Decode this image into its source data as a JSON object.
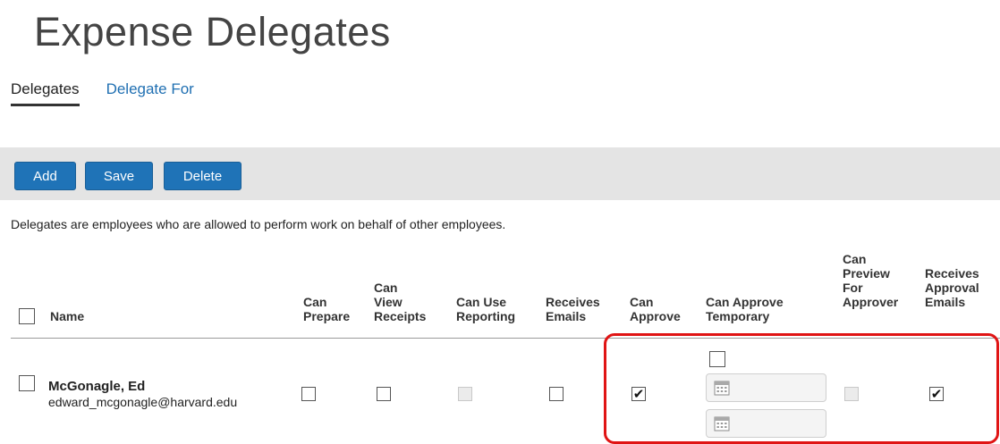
{
  "page": {
    "title": "Expense Delegates"
  },
  "tabs": [
    {
      "label": "Delegates",
      "active": true
    },
    {
      "label": "Delegate For",
      "active": false
    }
  ],
  "toolbar": {
    "add_label": "Add",
    "save_label": "Save",
    "delete_label": "Delete"
  },
  "description": "Delegates are employees who are allowed to perform work on behalf of other employees.",
  "table": {
    "headers": {
      "name": "Name",
      "can_prepare": "Can\nPrepare",
      "can_view_receipts": "Can\nView\nReceipts",
      "can_use_reporting": "Can Use\nReporting",
      "receives_emails": "Receives\nEmails",
      "can_approve": "Can\nApprove",
      "can_approve_temporary": "Can Approve\nTemporary",
      "can_preview_for_approver": "Can\nPreview\nFor\nApprover",
      "receives_approval_emails": "Receives\nApproval\nEmails"
    },
    "rows": [
      {
        "name": "McGonagle, Ed",
        "email": "edward_mcgonagle@harvard.edu",
        "selected": false,
        "can_prepare": false,
        "can_view_receipts": false,
        "can_use_reporting": false,
        "receives_emails": false,
        "can_approve": true,
        "can_approve_temporary": false,
        "can_preview_for_approver": false,
        "receives_approval_emails": true
      }
    ]
  },
  "colors": {
    "button_blue": "#1f73b7",
    "tab_link_blue": "#1f6fb2",
    "toolbar_gray": "#e4e4e4",
    "highlight_red": "#e01414"
  },
  "icons": {
    "check": "checkmark-icon",
    "calendar": "calendar-icon"
  }
}
